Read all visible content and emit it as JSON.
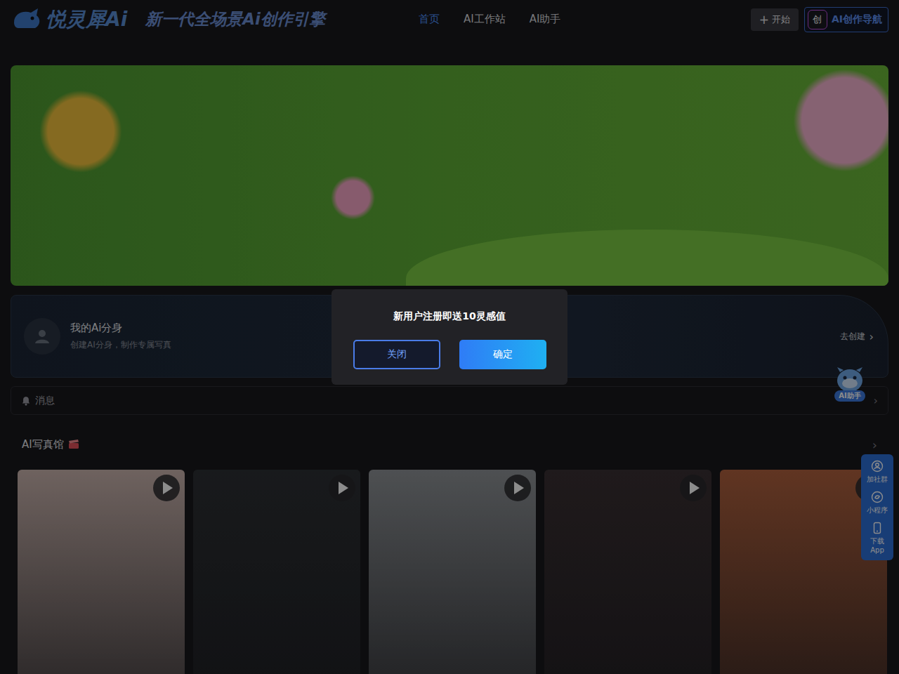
{
  "header": {
    "logo": "悦灵犀Ai",
    "tagline": "新一代全场景Ai创作引擎",
    "nav": [
      {
        "label": "首页",
        "selected": true
      },
      {
        "label": "AI工作站",
        "selected": false
      },
      {
        "label": "AI助手",
        "selected": false
      }
    ],
    "start_button": {
      "icon": "+",
      "label": "开始"
    },
    "nav_badge": {
      "icon": "创",
      "label": "AI创作导航"
    }
  },
  "avatar_card": {
    "title": "我的Ai分身",
    "subtitle": "创建AI分身，制作专属写真",
    "action": "去创建",
    "action_icon": "›"
  },
  "messages": {
    "label": "消息",
    "arrow": "›"
  },
  "section": {
    "title": "AI写真馆",
    "arrow": "›",
    "cards": [
      {
        "color": "#c9b3ad"
      },
      {
        "color": "#2d3034"
      },
      {
        "color": "#8e9296"
      },
      {
        "color": "#3a3033"
      },
      {
        "color": "#b0613e"
      }
    ]
  },
  "assistant_float": {
    "label": "AI助手"
  },
  "side_panel": [
    {
      "label": "加社群"
    },
    {
      "label": "小程序"
    },
    {
      "label": "下载App"
    }
  ],
  "dialog": {
    "message": "新用户注册即送10灵感值",
    "buttons": [
      {
        "label": "关闭",
        "kind": "secondary"
      },
      {
        "label": "确定",
        "kind": "primary"
      }
    ]
  }
}
